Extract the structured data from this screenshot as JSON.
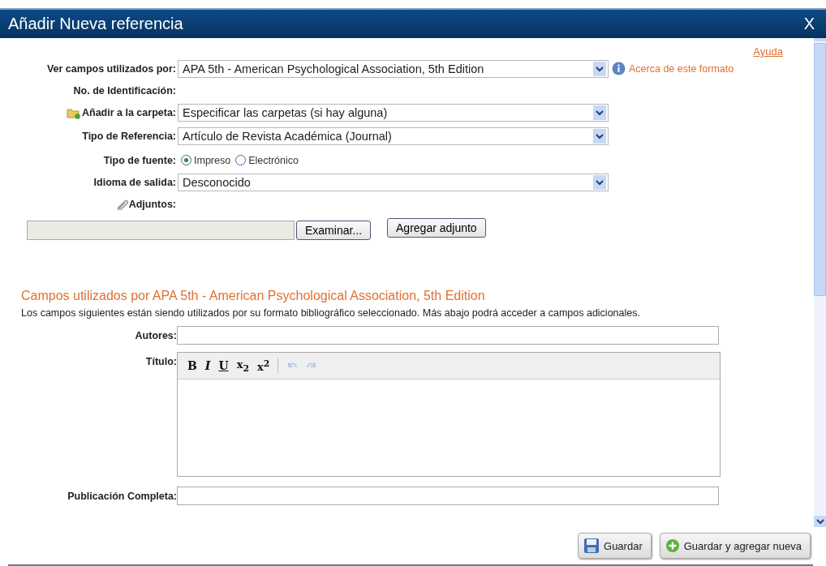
{
  "window": {
    "title": "Añadir Nueva referencia",
    "close": "X"
  },
  "help_link": "Ayuda",
  "fields": [
    {
      "kind": "select",
      "label": "Ver campos utilizados por:",
      "value": "APA 5th - American Psychological Association, 5th Edition",
      "info_link": "Acerca de este formato"
    },
    {
      "kind": "static",
      "label": "No. de Identificación:"
    },
    {
      "kind": "folder_select",
      "label": "Añadir a la carpeta:",
      "value": "Especificar las carpetas (si hay alguna)"
    },
    {
      "kind": "select",
      "label": "Tipo de Referencia:",
      "value": "Artículo de Revista Académica (Journal)"
    },
    {
      "kind": "radio",
      "label": "Tipo de fuente:",
      "options": [
        {
          "label": "Impreso",
          "selected": true
        },
        {
          "label": "Electrónico",
          "selected": false
        }
      ]
    },
    {
      "kind": "select",
      "label": "Idioma de salida:",
      "value": "Desconocido"
    },
    {
      "kind": "attachment",
      "label": "Adjuntos:"
    }
  ],
  "file_upload": {
    "browse": "Examinar...",
    "add": "Agregar adjunto"
  },
  "section": {
    "title": "Campos utilizados por APA 5th - American Psychological Association, 5th Edition",
    "description": "Los campos siguientes están siendo utilizados por su formato bibliográfico seleccionado. Más abajo podrá acceder a campos adicionales."
  },
  "ref_fields": [
    {
      "kind": "text",
      "label": "Autores:"
    },
    {
      "kind": "richtext",
      "label": "Título:",
      "toolbar": [
        {
          "kind": "bold",
          "label": "B",
          "disabled": false
        },
        {
          "kind": "italic",
          "label": "I",
          "disabled": false
        },
        {
          "kind": "underline",
          "label": "U",
          "disabled": false
        },
        {
          "kind": "subscript",
          "label": "x$_{2}$",
          "disabled": false
        },
        {
          "kind": "superscript",
          "label": "x$^{2}$",
          "disabled": false
        },
        {
          "kind": "undo",
          "disabled": true
        },
        {
          "kind": "redo",
          "disabled": true
        }
      ]
    },
    {
      "kind": "text",
      "label": "Publicación Completa:"
    }
  ],
  "buttons": [
    {
      "kind": "save",
      "label": "Guardar"
    },
    {
      "kind": "save_new",
      "label": "Guardar y agregar nueva"
    }
  ]
}
